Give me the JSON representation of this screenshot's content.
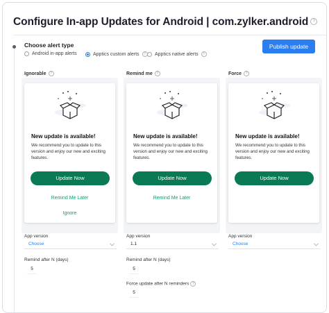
{
  "page": {
    "title": "Configure In-app Updates for Android | com.zylker.android",
    "help_glyph": "?"
  },
  "alert_type": {
    "label": "Choose alert type",
    "options": [
      {
        "label": "Android in-app alerts",
        "selected": false
      },
      {
        "label": "Apptics custom alerts",
        "selected": true
      },
      {
        "label": "Apptics native alerts",
        "selected": false
      }
    ]
  },
  "toolbar": {
    "publish_label": "Publish update"
  },
  "colors": {
    "accent": "#2a7ef0",
    "update_button": "#0a7a56",
    "link": "#149a6c"
  },
  "columns": [
    {
      "heading": "Ignorable",
      "card": {
        "title": "New update is available!",
        "message": "We recommend you to update to this version and enjoy our new and exciting features.",
        "update_label": "Update Now",
        "remind_label": "Remind Me Later",
        "ignore_label": "Ignore"
      },
      "app_version": {
        "label": "App version",
        "value": "Choose",
        "is_placeholder": true
      },
      "remind_after": {
        "label": "Remind after N (days)",
        "value": "5"
      }
    },
    {
      "heading": "Remind me",
      "card": {
        "title": "New update is available!",
        "message": "We recommend you to update to this version and enjoy our new and exciting features.",
        "update_label": "Update Now",
        "remind_label": "Remind Me Later"
      },
      "app_version": {
        "label": "App version",
        "value": "1.1",
        "is_placeholder": false
      },
      "remind_after": {
        "label": "Remind after N (days)",
        "value": "5"
      },
      "force_after": {
        "label": "Force update after N reminders",
        "value": "5"
      }
    },
    {
      "heading": "Force",
      "card": {
        "title": "New update is available!",
        "message": "We recommend you to update to this version and enjoy our new and exciting features.",
        "update_label": "Update Now"
      },
      "app_version": {
        "label": "App version",
        "value": "Choose",
        "is_placeholder": true
      }
    }
  ],
  "icons": [
    "help-icon",
    "gift-box-icon",
    "chevron-down-icon",
    "radio-button-icon"
  ]
}
